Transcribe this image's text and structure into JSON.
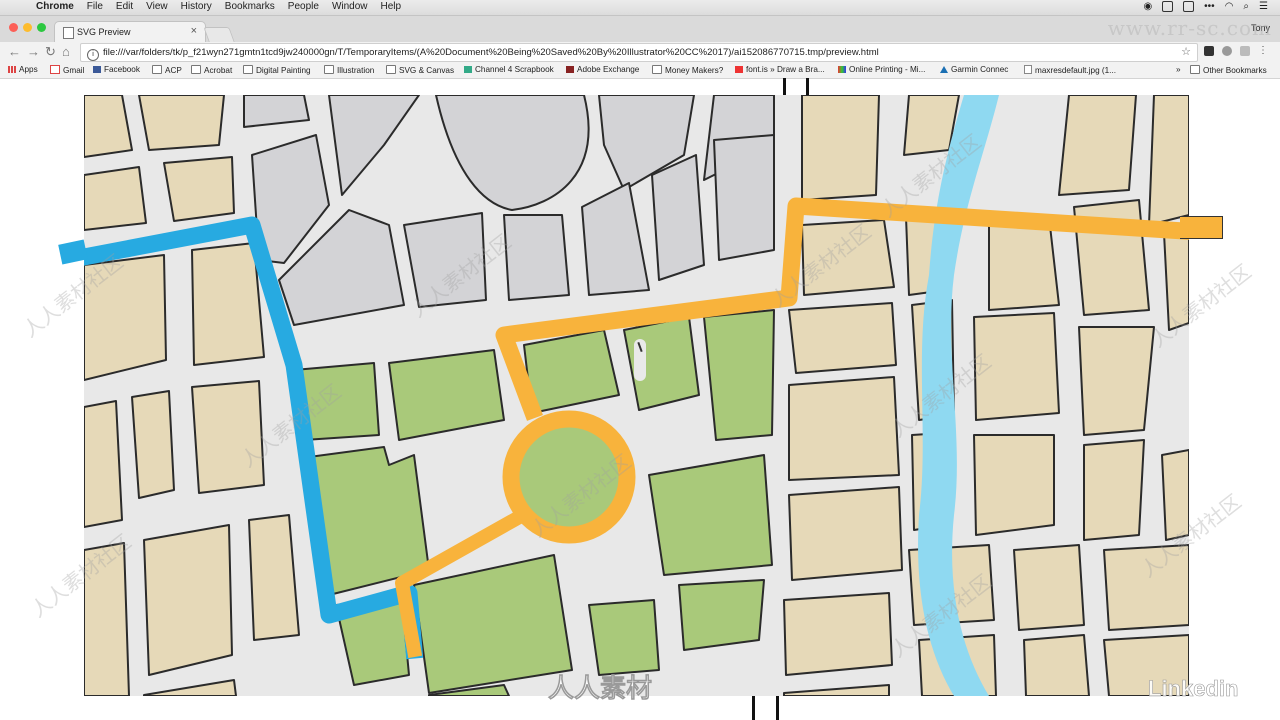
{
  "menubar": {
    "app": "Chrome",
    "items": [
      "File",
      "Edit",
      "View",
      "History",
      "Bookmarks",
      "People",
      "Window",
      "Help"
    ]
  },
  "tab": {
    "title": "SVG Preview",
    "close": "×"
  },
  "user": "Tony",
  "address": "file:///var/folders/tk/p_f21wyn271gmtn1tcd9jw240000gn/T/TemporaryItems/(A%20Document%20Being%20Saved%20By%20Illustrator%20CC%2017)/ai152086770715.tmp/preview.html",
  "bookmarks": {
    "items": [
      {
        "label": "Apps",
        "icon": "apps-grid-icon"
      },
      {
        "label": "Gmail",
        "icon": "gmail-icon"
      },
      {
        "label": "Facebook",
        "icon": "facebook-icon"
      },
      {
        "label": "ACP",
        "icon": "folder-icon"
      },
      {
        "label": "Acrobat",
        "icon": "folder-icon"
      },
      {
        "label": "Digital Painting",
        "icon": "folder-icon"
      },
      {
        "label": "Illustration",
        "icon": "folder-icon"
      },
      {
        "label": "SVG & Canvas",
        "icon": "folder-icon"
      },
      {
        "label": "Channel 4 Scrapbook",
        "icon": "channel4-icon"
      },
      {
        "label": "Adobe Exchange",
        "icon": "adobe-exchange-icon"
      },
      {
        "label": "Money Makers?",
        "icon": "folder-icon"
      },
      {
        "label": "font.is » Draw a Bra...",
        "icon": "fontis-icon"
      },
      {
        "label": "Online Printing - Mi...",
        "icon": "printing-icon"
      },
      {
        "label": "Garmin Connec",
        "icon": "garmin-icon"
      },
      {
        "label": "maxresdefault.jpg (1...",
        "icon": "file-icon"
      }
    ],
    "overflow": "»",
    "other": "Other Bookmarks"
  },
  "watermark": {
    "site": "www.rr-sc.com",
    "repeat": "人人素材社区",
    "center_logo": "人人素材",
    "brand": "Linkedin"
  },
  "colors": {
    "block": "#e6d9b8",
    "park": "#a9c97a",
    "plaza": "#d3d3d6",
    "road": "#e9e9e9",
    "river": "#8fd9f1",
    "route_orange": "#f8b33c",
    "route_blue": "#27aae1",
    "outline": "#2b2b2b"
  }
}
